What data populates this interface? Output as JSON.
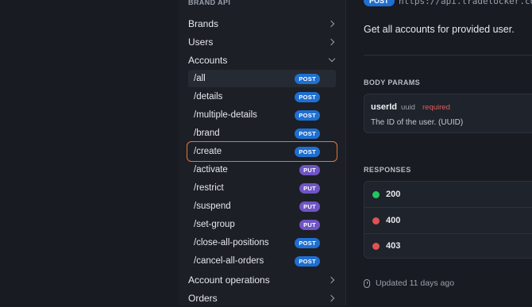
{
  "sidebar": {
    "section_title": "BRAND API",
    "groups_top": [
      {
        "label": "Brands"
      },
      {
        "label": "Users"
      },
      {
        "label": "Accounts"
      }
    ],
    "endpoints": [
      {
        "path": "/all",
        "method": "POST"
      },
      {
        "path": "/details",
        "method": "POST"
      },
      {
        "path": "/multiple-details",
        "method": "POST"
      },
      {
        "path": "/brand",
        "method": "POST"
      },
      {
        "path": "/create",
        "method": "POST"
      },
      {
        "path": "/activate",
        "method": "PUT"
      },
      {
        "path": "/restrict",
        "method": "PUT"
      },
      {
        "path": "/suspend",
        "method": "PUT"
      },
      {
        "path": "/set-group",
        "method": "PUT"
      },
      {
        "path": "/close-all-positions",
        "method": "POST"
      },
      {
        "path": "/cancel-all-orders",
        "method": "POST"
      }
    ],
    "groups_bottom": [
      {
        "label": "Account operations"
      },
      {
        "label": "Orders"
      }
    ]
  },
  "detail": {
    "method": "POST",
    "url": "https://api.tradelocker.com",
    "description": "Get all accounts for provided user.",
    "body_params_title": "BODY PARAMS",
    "param": {
      "name": "userId",
      "type": "uuid",
      "required": "required",
      "description": "The ID of the user. (UUID)"
    },
    "responses_title": "RESPONSES",
    "responses": [
      {
        "code": "200",
        "color": "#22c55e"
      },
      {
        "code": "400",
        "color": "#e05252"
      },
      {
        "code": "403",
        "color": "#e05252"
      }
    ],
    "updated": "Updated 11 days ago"
  },
  "colors": {
    "post": "#1f6fd1",
    "put": "#6f55c4",
    "highlight": "#e8743a"
  }
}
